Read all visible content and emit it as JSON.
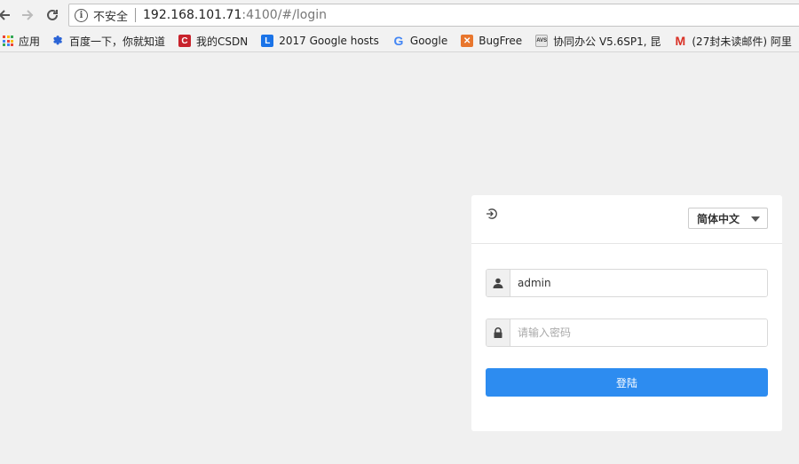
{
  "browser": {
    "security_label": "不安全",
    "url_host": "192.168.101.71",
    "url_path": ":4100/#/login",
    "bookmarks": [
      {
        "label": "应用",
        "icon": "apps-grid-icon"
      },
      {
        "label": "百度一下，你就知道",
        "icon": "baidu-paw-icon"
      },
      {
        "label": "我的CSDN",
        "icon": "csdn-icon"
      },
      {
        "label": "2017 Google hosts",
        "icon": "hosts-icon"
      },
      {
        "label": "Google",
        "icon": "google-icon"
      },
      {
        "label": "BugFree",
        "icon": "bugfree-icon"
      },
      {
        "label": "协同办公 V5.6SP1, 昆",
        "icon": "avs-icon"
      },
      {
        "label": "(27封未读邮件) 阿里",
        "icon": "mail-icon"
      }
    ]
  },
  "login": {
    "language": "简体中文",
    "username_value": "admin",
    "password_placeholder": "请输入密码",
    "submit_label": "登陆"
  },
  "colors": {
    "primary": "#2d8cf0",
    "page_bg": "#f0f0f0",
    "card_bg": "#ffffff"
  }
}
